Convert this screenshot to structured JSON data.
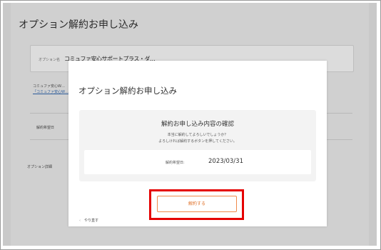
{
  "page": {
    "title": "オプション解約お申し込み",
    "notice_small": "オプション名",
    "notice_link": "コミュファ安心サポートプラス・ダ…",
    "text_line_a": "コミュファ安心W…",
    "text_line_b": "「コミュファ安心W…",
    "row_label": "解約希望日",
    "option_detail": "オプション詳細"
  },
  "modal": {
    "title": "オプション解約お申し込み",
    "card": {
      "title": "解約お申し込み内容の確認",
      "desc_line1": "本当に解約してよろしいでしょうか？",
      "desc_line2": "よろしければ解約するボタンを押してください。",
      "date_label": "解約希望日:",
      "date_value": "2023/03/31"
    },
    "cancel_button": "解約する",
    "redo_chevron": "‹",
    "redo_link": "やり直す"
  },
  "colors": {
    "accent": "#f08a4b",
    "highlight": "#e50000",
    "overlay": "#c9c9c9"
  }
}
